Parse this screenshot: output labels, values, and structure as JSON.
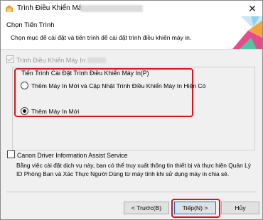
{
  "window": {
    "title": "Trình Điều Khiển Máy",
    "close_glyph": "✕"
  },
  "header": {
    "title": "Chọn Tiến Trình",
    "subtitle": "Chọn mục để cài đặt và tiến trình để cài đặt trình điều khiển máy in."
  },
  "driver_check": {
    "label": "Trình Điều Khiển Máy In",
    "checked": true,
    "disabled": true
  },
  "process_group": {
    "legend": "Tiến Trình Cài Đặt Trình Điều Khiển Máy In(P)",
    "options": [
      {
        "label": "Thêm Máy In Mới và Cập Nhật Trình Điều Khiển Máy In Hiện Có",
        "selected": false
      },
      {
        "label": "Thêm Máy In Mới",
        "selected": true
      }
    ]
  },
  "service": {
    "label": "Canon Driver Information Assist Service",
    "checked": false,
    "description": "Bằng việc cài đặt dịch vụ này, bạn có thể truy xuất thông tin thiết bị và thực hiện Quản Lý ID Phòng Ban và Xác Thực Người Dùng từ máy tính khi sử dụng máy in chia sẻ."
  },
  "buttons": {
    "back": "< Trước(B)",
    "next": "Tiếp(N) >",
    "cancel": "Hủy"
  },
  "colors": {
    "highlight": "#d9141f",
    "accent": "#0078d7"
  },
  "icons": [
    "app-icon",
    "close-icon",
    "checkbox-checked-icon",
    "radio-icon",
    "header-graphic"
  ]
}
